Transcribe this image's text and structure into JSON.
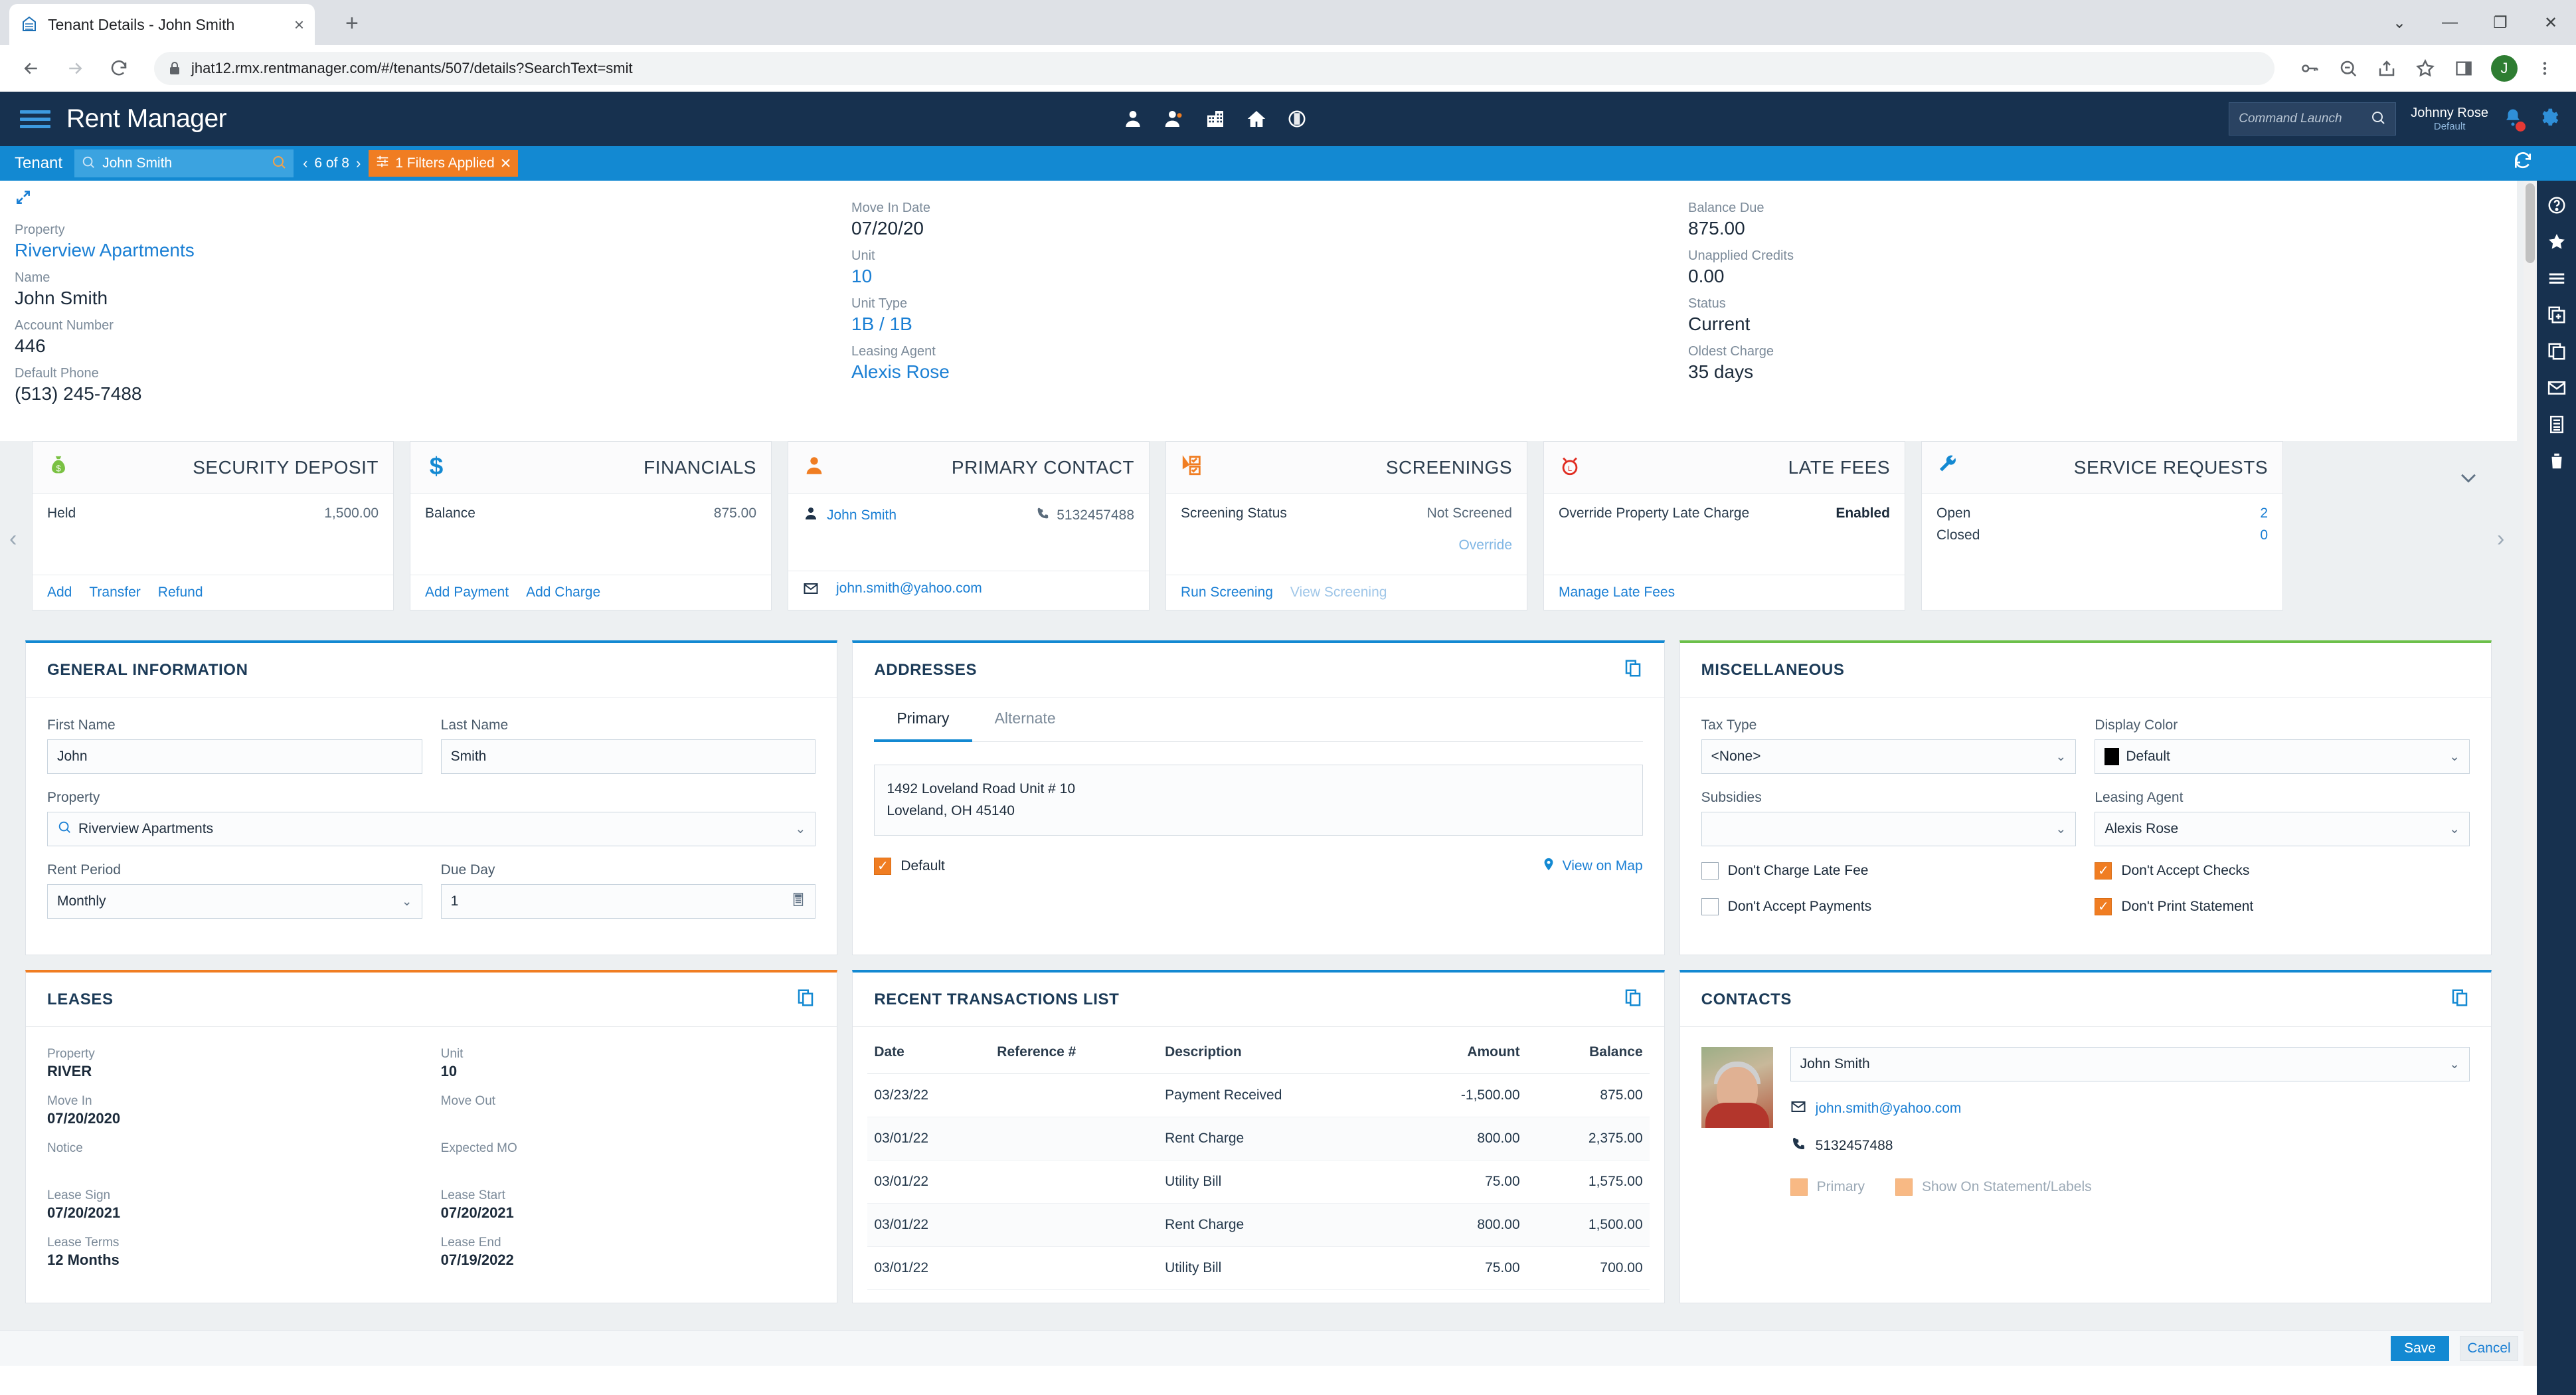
{
  "browser": {
    "tab_title": "Tenant Details - John Smith",
    "favicon_name": "rentmanager-favicon",
    "url": "jhat12.rmx.rentmanager.com/#/tenants/507/details?SearchText=smit",
    "new_tab_label": "+",
    "close_tab_label": "×",
    "profile_initial": "J",
    "window": {
      "minimize": "—",
      "maximize": "❐",
      "close": "✕",
      "chevron": "⌄"
    }
  },
  "header": {
    "app_name": "Rent Manager",
    "command_launch_placeholder": "Command Launch",
    "user_name": "Johnny Rose",
    "user_role": "Default",
    "nav_icons": [
      "tenant-icon",
      "prospect-icon",
      "property-icon",
      "home-icon",
      "info-icon"
    ]
  },
  "tenant_bar": {
    "label": "Tenant",
    "search_value": "John Smith",
    "pager_text": "6 of 8",
    "prev": "‹",
    "next": "›",
    "filters_text": "1 Filters Applied",
    "filters_clear": "✕"
  },
  "summary": {
    "col1": [
      {
        "label": "Property",
        "value": "Riverview Apartments",
        "link": true
      },
      {
        "label": "Name",
        "value": "John Smith",
        "link": false
      },
      {
        "label": "Account Number",
        "value": "446",
        "link": false
      },
      {
        "label": "Default Phone",
        "value": "(513) 245-7488",
        "link": false
      }
    ],
    "col2": [
      {
        "label": "Move In Date",
        "value": "07/20/20",
        "link": false
      },
      {
        "label": "Unit",
        "value": "10",
        "link": true
      },
      {
        "label": "Unit Type",
        "value": "1B / 1B",
        "link": true
      },
      {
        "label": "Leasing Agent",
        "value": "Alexis Rose",
        "link": true
      }
    ],
    "col3": [
      {
        "label": "Balance Due",
        "value": "875.00",
        "link": false
      },
      {
        "label": "Unapplied Credits",
        "value": "0.00",
        "link": false
      },
      {
        "label": "Status",
        "value": "Current",
        "link": false
      },
      {
        "label": "Oldest Charge",
        "value": "35 days",
        "link": false
      }
    ]
  },
  "cards": [
    {
      "title": "SECURITY DEPOSIT",
      "icon": "money-bag-icon",
      "rows": [
        {
          "label": "Held",
          "value": "1,500.00"
        }
      ],
      "links": [
        {
          "text": "Add",
          "muted": false
        },
        {
          "text": "Transfer",
          "muted": false
        },
        {
          "text": "Refund",
          "muted": false
        }
      ]
    },
    {
      "title": "FINANCIALS",
      "icon": "dollar-icon",
      "rows": [
        {
          "label": "Balance",
          "value": "875.00"
        }
      ],
      "links": [
        {
          "text": "Add Payment",
          "muted": false
        },
        {
          "text": "Add Charge",
          "muted": false
        }
      ]
    },
    {
      "title": "PRIMARY CONTACT",
      "icon": "person-icon",
      "contact_name": "John Smith",
      "contact_phone": "5132457488",
      "contact_email": "john.smith@yahoo.com"
    },
    {
      "title": "SCREENINGS",
      "icon": "screening-icon",
      "rows": [
        {
          "label": "Screening Status",
          "value": "Not Screened"
        }
      ],
      "right_link": "Override",
      "links": [
        {
          "text": "Run Screening",
          "muted": false
        },
        {
          "text": "View Screening",
          "muted": true
        }
      ]
    },
    {
      "title": "LATE FEES",
      "icon": "alarm-clock-icon",
      "rows": [
        {
          "label": "Override Property Late Charge",
          "value": "Enabled"
        }
      ],
      "links": [
        {
          "text": "Manage Late Fees",
          "muted": false
        }
      ]
    },
    {
      "title": "SERVICE REQUESTS",
      "icon": "wrench-icon",
      "rows": [
        {
          "label": "Open",
          "value": "2"
        },
        {
          "label": "Closed",
          "value": "0"
        }
      ],
      "links": []
    }
  ],
  "carousel": {
    "prev": "‹",
    "next": "›"
  },
  "general_information": {
    "title": "GENERAL INFORMATION",
    "first_name_label": "First Name",
    "first_name_value": "John",
    "last_name_label": "Last Name",
    "last_name_value": "Smith",
    "property_label": "Property",
    "property_value": "Riverview Apartments",
    "rent_period_label": "Rent Period",
    "rent_period_value": "Monthly",
    "due_day_label": "Due Day",
    "due_day_value": "1"
  },
  "addresses": {
    "title": "ADDRESSES",
    "tabs": [
      {
        "label": "Primary",
        "active": true
      },
      {
        "label": "Alternate",
        "active": false
      }
    ],
    "address_line1": "1492 Loveland Road Unit # 10",
    "address_line2": "Loveland, OH 45140",
    "default_label": "Default",
    "default_checked": true,
    "view_on_map": "View on Map"
  },
  "miscellaneous": {
    "title": "MISCELLANEOUS",
    "tax_type_label": "Tax Type",
    "tax_type_value": "<None>",
    "display_color_label": "Display Color",
    "display_color_value": "Default",
    "display_color_swatch": "#000000",
    "subsidies_label": "Subsidies",
    "subsidies_value": "",
    "leasing_agent_label": "Leasing Agent",
    "leasing_agent_value": "Alexis Rose",
    "checkboxes": [
      {
        "label": "Don't Charge Late Fee",
        "checked": false
      },
      {
        "label": "Don't Accept Checks",
        "checked": true
      },
      {
        "label": "Don't Accept Payments",
        "checked": false
      },
      {
        "label": "Don't Print Statement",
        "checked": true
      }
    ]
  },
  "leases": {
    "title": "LEASES",
    "fields": [
      {
        "label": "Property",
        "value": "RIVER"
      },
      {
        "label": "Unit",
        "value": "10"
      },
      {
        "label": "Move In",
        "value": "07/20/2020"
      },
      {
        "label": "Move Out",
        "value": ""
      },
      {
        "label": "Notice",
        "value": ""
      },
      {
        "label": "Expected MO",
        "value": ""
      },
      {
        "label": "Lease Sign",
        "value": "07/20/2021"
      },
      {
        "label": "Lease Start",
        "value": "07/20/2021"
      },
      {
        "label": "Lease Terms",
        "value": "12 Months"
      },
      {
        "label": "Lease End",
        "value": "07/19/2022"
      }
    ]
  },
  "transactions": {
    "title": "RECENT TRANSACTIONS LIST",
    "columns": [
      "Date",
      "Reference #",
      "Description",
      "Amount",
      "Balance"
    ],
    "rows": [
      {
        "date": "03/23/22",
        "reference": "",
        "description": "Payment Received",
        "amount": "-1,500.00",
        "balance": "875.00",
        "negative": true
      },
      {
        "date": "03/01/22",
        "reference": "",
        "description": "Rent Charge",
        "amount": "800.00",
        "balance": "2,375.00",
        "negative": false
      },
      {
        "date": "03/01/22",
        "reference": "",
        "description": "Utility Bill",
        "amount": "75.00",
        "balance": "1,575.00",
        "negative": false
      },
      {
        "date": "03/01/22",
        "reference": "",
        "description": "Rent Charge",
        "amount": "800.00",
        "balance": "1,500.00",
        "negative": false
      },
      {
        "date": "03/01/22",
        "reference": "",
        "description": "Utility Bill",
        "amount": "75.00",
        "balance": "700.00",
        "negative": false
      }
    ]
  },
  "contacts": {
    "title": "CONTACTS",
    "selected_contact": "John Smith",
    "email": "john.smith@yahoo.com",
    "phone": "5132457488",
    "checkboxes": [
      {
        "label": "Primary",
        "checked": true
      },
      {
        "label": "Show On Statement/Labels",
        "checked": true
      }
    ]
  },
  "footer": {
    "save_label": "Save",
    "cancel_label": "Cancel"
  },
  "right_rail_icons": [
    "help-icon",
    "star-icon",
    "list-icon",
    "add-document-icon",
    "copy-icon",
    "mail-icon",
    "report-icon",
    "trash-icon"
  ],
  "colors": {
    "brand_blue": "#1389d2",
    "header_navy": "#17314f",
    "accent_orange": "#f07d22",
    "accent_green": "#6cc04a",
    "link_blue": "#1a7fd4"
  }
}
